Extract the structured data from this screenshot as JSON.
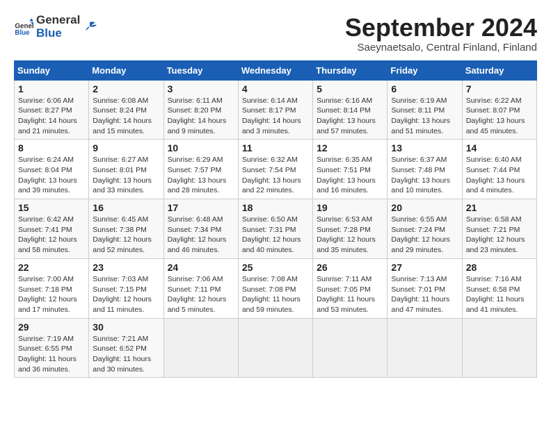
{
  "logo": {
    "general": "General",
    "blue": "Blue"
  },
  "title": "September 2024",
  "subtitle": "Saeynaetsalo, Central Finland, Finland",
  "days_of_week": [
    "Sunday",
    "Monday",
    "Tuesday",
    "Wednesday",
    "Thursday",
    "Friday",
    "Saturday"
  ],
  "weeks": [
    [
      {
        "num": "1",
        "sunrise": "Sunrise: 6:06 AM",
        "sunset": "Sunset: 8:27 PM",
        "daylight": "Daylight: 14 hours and 21 minutes."
      },
      {
        "num": "2",
        "sunrise": "Sunrise: 6:08 AM",
        "sunset": "Sunset: 8:24 PM",
        "daylight": "Daylight: 14 hours and 15 minutes."
      },
      {
        "num": "3",
        "sunrise": "Sunrise: 6:11 AM",
        "sunset": "Sunset: 8:20 PM",
        "daylight": "Daylight: 14 hours and 9 minutes."
      },
      {
        "num": "4",
        "sunrise": "Sunrise: 6:14 AM",
        "sunset": "Sunset: 8:17 PM",
        "daylight": "Daylight: 14 hours and 3 minutes."
      },
      {
        "num": "5",
        "sunrise": "Sunrise: 6:16 AM",
        "sunset": "Sunset: 8:14 PM",
        "daylight": "Daylight: 13 hours and 57 minutes."
      },
      {
        "num": "6",
        "sunrise": "Sunrise: 6:19 AM",
        "sunset": "Sunset: 8:11 PM",
        "daylight": "Daylight: 13 hours and 51 minutes."
      },
      {
        "num": "7",
        "sunrise": "Sunrise: 6:22 AM",
        "sunset": "Sunset: 8:07 PM",
        "daylight": "Daylight: 13 hours and 45 minutes."
      }
    ],
    [
      {
        "num": "8",
        "sunrise": "Sunrise: 6:24 AM",
        "sunset": "Sunset: 8:04 PM",
        "daylight": "Daylight: 13 hours and 39 minutes."
      },
      {
        "num": "9",
        "sunrise": "Sunrise: 6:27 AM",
        "sunset": "Sunset: 8:01 PM",
        "daylight": "Daylight: 13 hours and 33 minutes."
      },
      {
        "num": "10",
        "sunrise": "Sunrise: 6:29 AM",
        "sunset": "Sunset: 7:57 PM",
        "daylight": "Daylight: 13 hours and 28 minutes."
      },
      {
        "num": "11",
        "sunrise": "Sunrise: 6:32 AM",
        "sunset": "Sunset: 7:54 PM",
        "daylight": "Daylight: 13 hours and 22 minutes."
      },
      {
        "num": "12",
        "sunrise": "Sunrise: 6:35 AM",
        "sunset": "Sunset: 7:51 PM",
        "daylight": "Daylight: 13 hours and 16 minutes."
      },
      {
        "num": "13",
        "sunrise": "Sunrise: 6:37 AM",
        "sunset": "Sunset: 7:48 PM",
        "daylight": "Daylight: 13 hours and 10 minutes."
      },
      {
        "num": "14",
        "sunrise": "Sunrise: 6:40 AM",
        "sunset": "Sunset: 7:44 PM",
        "daylight": "Daylight: 13 hours and 4 minutes."
      }
    ],
    [
      {
        "num": "15",
        "sunrise": "Sunrise: 6:42 AM",
        "sunset": "Sunset: 7:41 PM",
        "daylight": "Daylight: 12 hours and 58 minutes."
      },
      {
        "num": "16",
        "sunrise": "Sunrise: 6:45 AM",
        "sunset": "Sunset: 7:38 PM",
        "daylight": "Daylight: 12 hours and 52 minutes."
      },
      {
        "num": "17",
        "sunrise": "Sunrise: 6:48 AM",
        "sunset": "Sunset: 7:34 PM",
        "daylight": "Daylight: 12 hours and 46 minutes."
      },
      {
        "num": "18",
        "sunrise": "Sunrise: 6:50 AM",
        "sunset": "Sunset: 7:31 PM",
        "daylight": "Daylight: 12 hours and 40 minutes."
      },
      {
        "num": "19",
        "sunrise": "Sunrise: 6:53 AM",
        "sunset": "Sunset: 7:28 PM",
        "daylight": "Daylight: 12 hours and 35 minutes."
      },
      {
        "num": "20",
        "sunrise": "Sunrise: 6:55 AM",
        "sunset": "Sunset: 7:24 PM",
        "daylight": "Daylight: 12 hours and 29 minutes."
      },
      {
        "num": "21",
        "sunrise": "Sunrise: 6:58 AM",
        "sunset": "Sunset: 7:21 PM",
        "daylight": "Daylight: 12 hours and 23 minutes."
      }
    ],
    [
      {
        "num": "22",
        "sunrise": "Sunrise: 7:00 AM",
        "sunset": "Sunset: 7:18 PM",
        "daylight": "Daylight: 12 hours and 17 minutes."
      },
      {
        "num": "23",
        "sunrise": "Sunrise: 7:03 AM",
        "sunset": "Sunset: 7:15 PM",
        "daylight": "Daylight: 12 hours and 11 minutes."
      },
      {
        "num": "24",
        "sunrise": "Sunrise: 7:06 AM",
        "sunset": "Sunset: 7:11 PM",
        "daylight": "Daylight: 12 hours and 5 minutes."
      },
      {
        "num": "25",
        "sunrise": "Sunrise: 7:08 AM",
        "sunset": "Sunset: 7:08 PM",
        "daylight": "Daylight: 11 hours and 59 minutes."
      },
      {
        "num": "26",
        "sunrise": "Sunrise: 7:11 AM",
        "sunset": "Sunset: 7:05 PM",
        "daylight": "Daylight: 11 hours and 53 minutes."
      },
      {
        "num": "27",
        "sunrise": "Sunrise: 7:13 AM",
        "sunset": "Sunset: 7:01 PM",
        "daylight": "Daylight: 11 hours and 47 minutes."
      },
      {
        "num": "28",
        "sunrise": "Sunrise: 7:16 AM",
        "sunset": "Sunset: 6:58 PM",
        "daylight": "Daylight: 11 hours and 41 minutes."
      }
    ],
    [
      {
        "num": "29",
        "sunrise": "Sunrise: 7:19 AM",
        "sunset": "Sunset: 6:55 PM",
        "daylight": "Daylight: 11 hours and 36 minutes."
      },
      {
        "num": "30",
        "sunrise": "Sunrise: 7:21 AM",
        "sunset": "Sunset: 6:52 PM",
        "daylight": "Daylight: 11 hours and 30 minutes."
      },
      null,
      null,
      null,
      null,
      null
    ]
  ]
}
